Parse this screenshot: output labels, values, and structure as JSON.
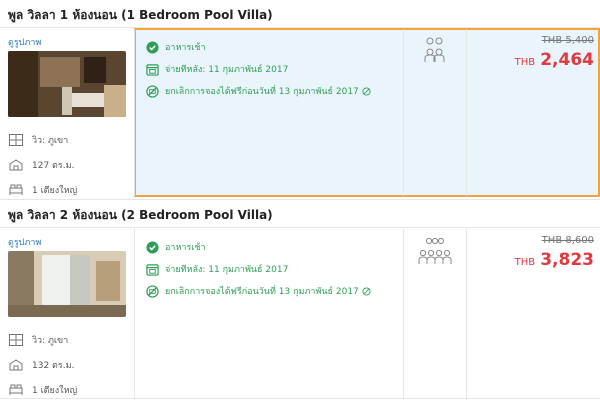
{
  "rooms": [
    {
      "title": "พูล วิลลา 1 ห้องนอน (1 Bedroom Pool Villa)",
      "photos_link": "ดูรูปภาพ",
      "view": "วิว: ภูเขา",
      "size": "127 ตร.ม.",
      "bed": "1 เตียงใหญ่",
      "benefits": {
        "breakfast": "อาหารเช้า",
        "pay_later": "จ่ายทีหลัง: 11 กุมภาพันธ์ 2017",
        "free_cancel": "ยกเลิกการจองได้ฟรีก่อนวันที่ 13 กุมภาพันธ์ 2017"
      },
      "occupancy": 2,
      "old_price": "THB 5,400",
      "currency": "THB",
      "price": "2,464",
      "selected": true
    },
    {
      "title": "พูล วิลลา 2 ห้องนอน (2 Bedroom Pool Villa)",
      "photos_link": "ดูรูปภาพ",
      "view": "วิว: ภูเขา",
      "size": "132 ตร.ม.",
      "bed": "1 เตียงใหญ่",
      "benefits": {
        "breakfast": "อาหารเช้า",
        "pay_later": "จ่ายทีหลัง: 11 กุมภาพันธ์ 2017",
        "free_cancel": "ยกเลิกการจองได้ฟรีก่อนวันที่ 13 กุมภาพันธ์ 2017"
      },
      "occupancy": 4,
      "old_price": "THB 8,600",
      "currency": "THB",
      "price": "3,823",
      "selected": false
    }
  ],
  "colors": {
    "accent_green": "#2e9e57",
    "price_red": "#e0393e",
    "selected_orange": "#f5a13d",
    "link_blue": "#2a7ab8"
  },
  "icons": [
    "check-circle-icon",
    "calendar-icon",
    "no-card-icon",
    "view-icon",
    "area-icon",
    "bed-icon",
    "person-icon"
  ]
}
